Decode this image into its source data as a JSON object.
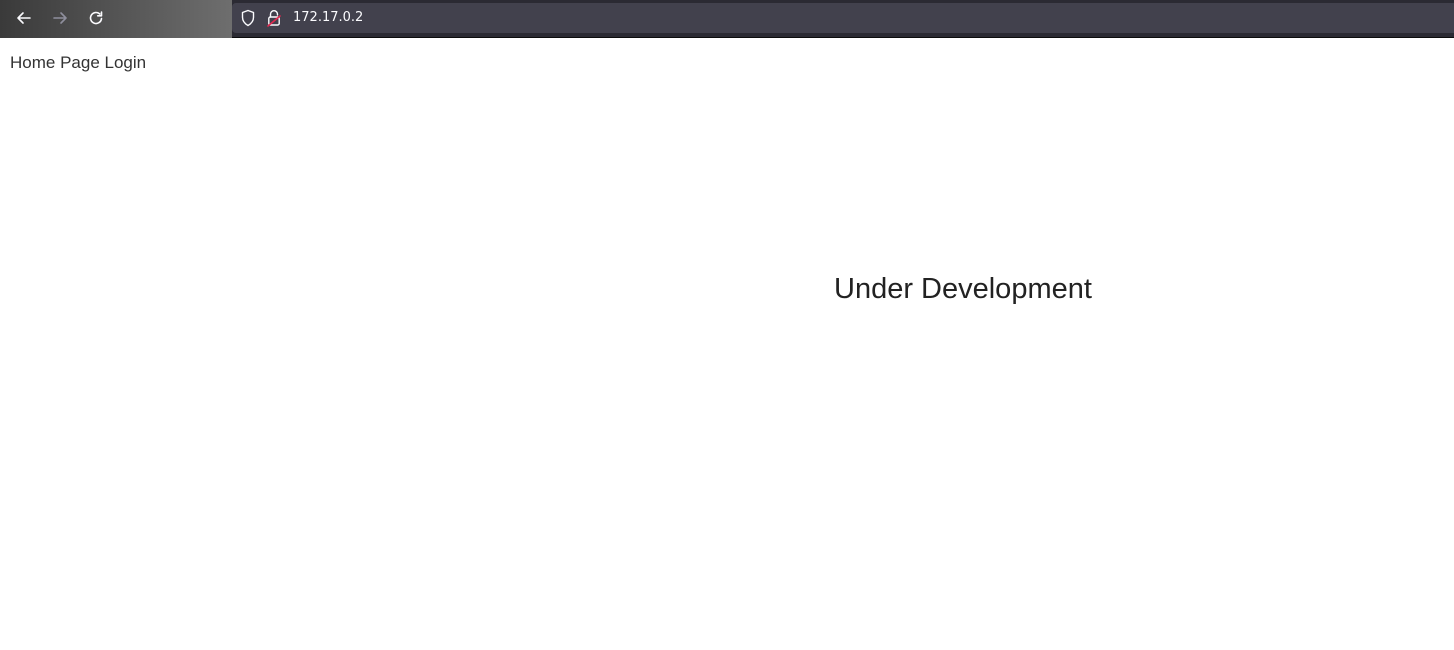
{
  "browser": {
    "url": "172.17.0.2",
    "icons": {
      "back": "arrow-left-icon",
      "forward": "arrow-right-icon",
      "reload": "reload-icon",
      "shield": "shield-icon",
      "lock": "insecure-lock-icon"
    },
    "colors": {
      "chrome_bg": "#2b2a33",
      "urlbar_bg": "#42414d",
      "lock_accent": "#e22850"
    }
  },
  "page": {
    "nav": {
      "home_label": "Home Page",
      "login_label": "Login"
    },
    "heading": "Under Development"
  }
}
